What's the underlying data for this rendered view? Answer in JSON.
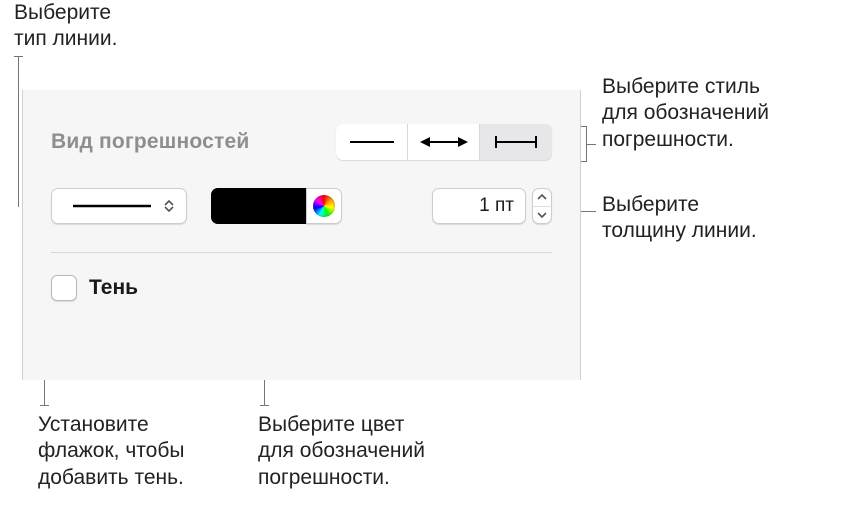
{
  "callouts": {
    "line_type": "Выберите\nтип линии.",
    "error_style": "Выберите стиль\nдля обозначений\nпогрешности.",
    "line_width": "Выберите\nтолщину линии.",
    "shadow_flag": "Установите\nфлажок, чтобы\nдобавить тень.",
    "color_pick": "Выберите цвет\nдля обозначений\nпогрешности."
  },
  "panel": {
    "section_title": "Вид погрешностей",
    "line_width_value": "1 пт",
    "shadow_label": "Тень"
  }
}
